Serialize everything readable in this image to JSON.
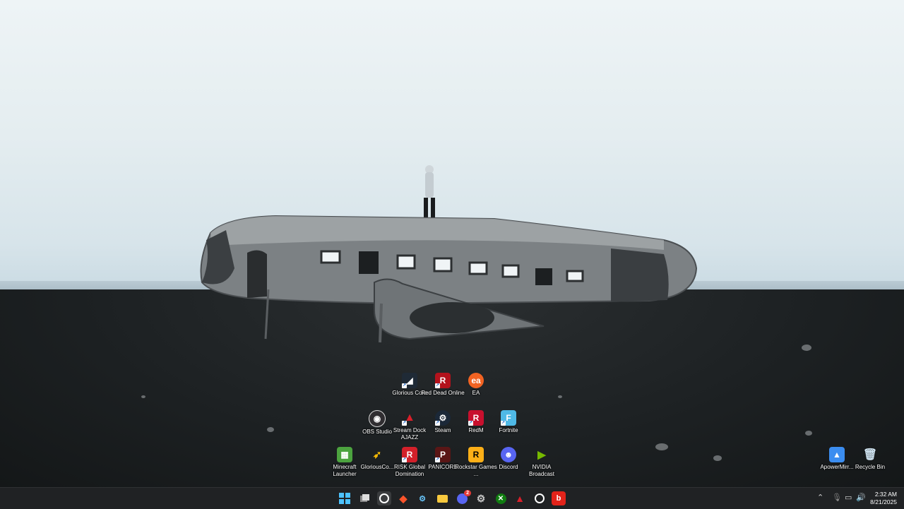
{
  "desktop": {
    "icons": [
      {
        "label": "Glorious Core",
        "icon": "glorious-core-icon"
      },
      {
        "label": "Red Dead Online",
        "icon": "red-dead-online-icon"
      },
      {
        "label": "EA",
        "icon": "ea-icon"
      },
      {
        "label": "OBS Studio",
        "icon": "obs-icon"
      },
      {
        "label": "Stream Dock AJAZZ",
        "icon": "stream-dock-icon"
      },
      {
        "label": "Steam",
        "icon": "steam-icon"
      },
      {
        "label": "RedM",
        "icon": "redm-icon"
      },
      {
        "label": "Fortnite",
        "icon": "fortnite-icon"
      },
      {
        "label": "Minecraft Launcher",
        "icon": "minecraft-icon"
      },
      {
        "label": "GloriousCo...",
        "icon": "glorious-icon"
      },
      {
        "label": "RISK Global Domination",
        "icon": "risk-icon"
      },
      {
        "label": "PANICORE",
        "icon": "panicore-icon"
      },
      {
        "label": "Rockstar Games ...",
        "icon": "rockstar-icon"
      },
      {
        "label": "Discord",
        "icon": "discord-icon"
      },
      {
        "label": "NVIDIA Broadcast",
        "icon": "nvidia-broadcast-icon"
      },
      {
        "label": "ApowerMirr...",
        "icon": "apowermirror-icon"
      },
      {
        "label": "Recycle Bin",
        "icon": "recycle-bin-icon"
      }
    ]
  },
  "taskbar": {
    "apps": [
      "start",
      "task-view",
      "obs",
      "brave",
      "steam",
      "file-explorer",
      "discord",
      "settings",
      "xbox",
      "stream-dock",
      "epic",
      "roblox"
    ],
    "discord_badge": "2",
    "clock": {
      "time": "2:32 AM",
      "date": "8/21/2025"
    }
  },
  "colors": {
    "taskbar": "#202224",
    "accent": "#0078d4"
  }
}
